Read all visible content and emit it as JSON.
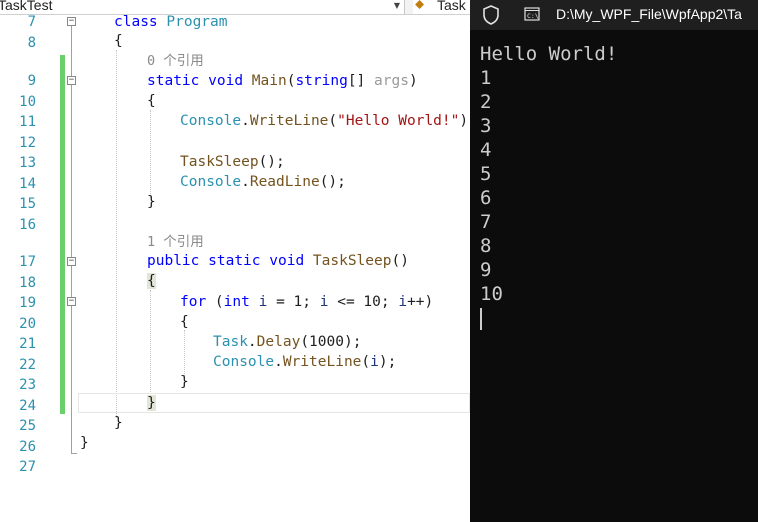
{
  "editor": {
    "nav": {
      "left_combo": "TaskTest",
      "right_combo": "Task"
    },
    "lines": [
      {
        "n": "7"
      },
      {
        "n": "8"
      },
      {
        "n": "9"
      },
      {
        "n": "10"
      },
      {
        "n": "11"
      },
      {
        "n": "12"
      },
      {
        "n": "13"
      },
      {
        "n": "14"
      },
      {
        "n": "15"
      },
      {
        "n": "16"
      },
      {
        "n": "17"
      },
      {
        "n": "18"
      },
      {
        "n": "19"
      },
      {
        "n": "20"
      },
      {
        "n": "21"
      },
      {
        "n": "22"
      },
      {
        "n": "23"
      },
      {
        "n": "24"
      },
      {
        "n": "25"
      },
      {
        "n": "26"
      },
      {
        "n": "27"
      }
    ],
    "codelens": {
      "main_refs": "0 个引用",
      "tasksleep_refs": "1 个引用"
    },
    "code": {
      "class_kw": "class",
      "class_name": "Program",
      "static_kw": "static",
      "void_kw": "void",
      "main_name": "Main",
      "string_kw": "string",
      "args": "args",
      "console": "Console",
      "writeline": "WriteLine",
      "hello": "\"Hello World!\"",
      "tasksleep": "TaskSleep",
      "readline": "ReadLine",
      "public_kw": "public",
      "for_kw": "for",
      "int_kw": "int",
      "i": "i",
      "one": "1",
      "ten": "10",
      "task": "Task",
      "delay": "Delay",
      "thousand": "1000"
    }
  },
  "console": {
    "title_path": "D:\\My_WPF_File\\WpfApp2\\Ta",
    "output": [
      "Hello World!",
      "1",
      "2",
      "3",
      "4",
      "5",
      "6",
      "7",
      "8",
      "9",
      "10"
    ]
  },
  "colors": {
    "keyword": "#0000ff",
    "type": "#2b91af",
    "method": "#74531f",
    "string": "#a31515",
    "parameter": "#1f377f",
    "line_number": "#2b91af",
    "change_bar": "#6bd06b",
    "console_bg": "#0c0c0c",
    "console_text": "#cccccc"
  },
  "icons": [
    "chevron-down-icon",
    "class-icon",
    "shield-icon",
    "console-app-icon",
    "collapse-icon"
  ]
}
